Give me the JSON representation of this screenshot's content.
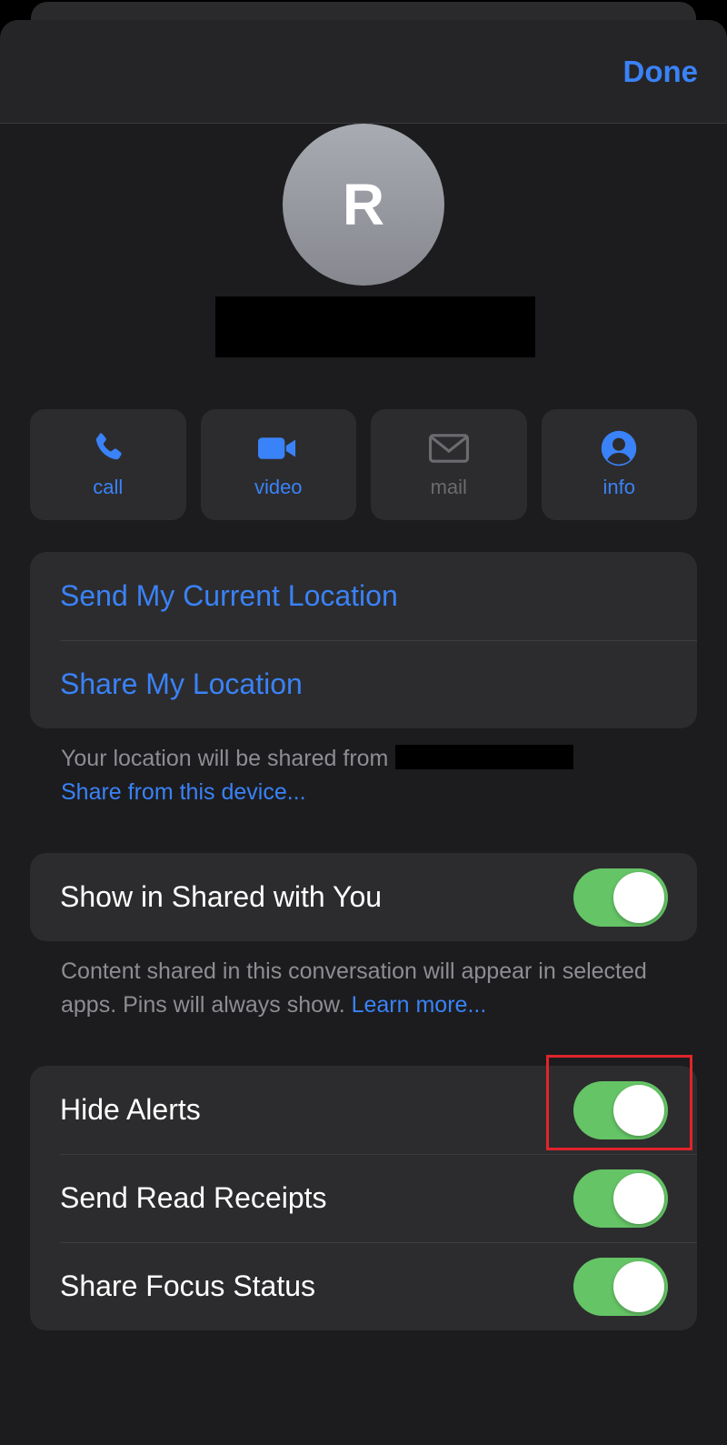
{
  "navbar": {
    "done_label": "Done"
  },
  "contact": {
    "avatar_initial": "R"
  },
  "actions": [
    {
      "label": "call",
      "icon": "phone-icon",
      "enabled": true
    },
    {
      "label": "video",
      "icon": "video-camera-icon",
      "enabled": true
    },
    {
      "label": "mail",
      "icon": "envelope-icon",
      "enabled": false
    },
    {
      "label": "info",
      "icon": "person-circle-icon",
      "enabled": true
    }
  ],
  "location": {
    "send_current": "Send My Current Location",
    "share": "Share My Location",
    "footnote": "Your location will be shared from",
    "share_from_device": "Share from this device..."
  },
  "shared_with_you": {
    "label": "Show in Shared with You",
    "on": true,
    "footnote": "Content shared in this conversation will appear in selected apps. Pins will always show.",
    "learn_more": "Learn more..."
  },
  "settings": [
    {
      "label": "Hide Alerts",
      "on": true
    },
    {
      "label": "Send Read Receipts",
      "on": true
    },
    {
      "label": "Share Focus Status",
      "on": true
    }
  ],
  "colors": {
    "accent": "#3a82f7",
    "toggle_on": "#65c466",
    "highlight": "#e0242b",
    "background": "#1c1c1e",
    "cell": "#2c2c2e"
  }
}
